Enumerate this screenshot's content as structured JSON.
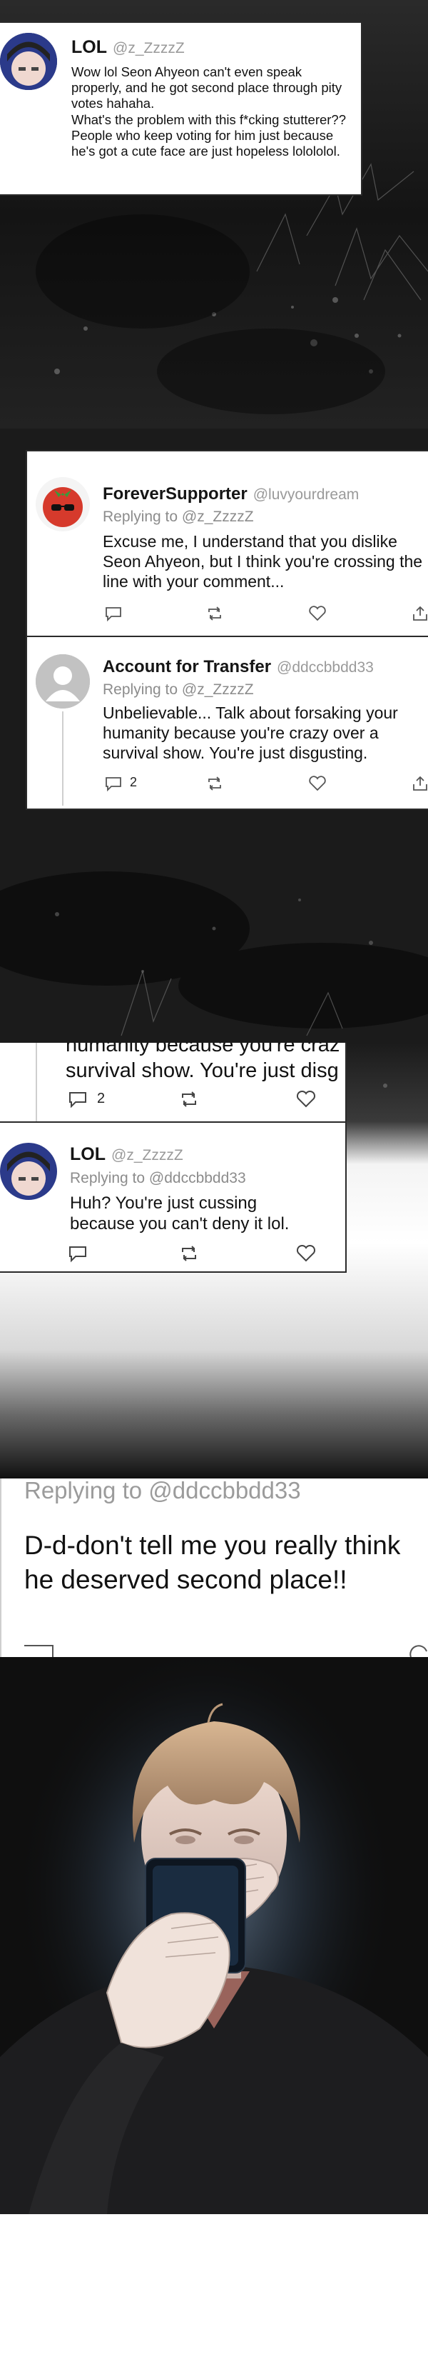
{
  "panel1": {
    "tweet": {
      "name": "LOL",
      "handle": "@z_ZzzzZ",
      "text": "Wow lol Seon Ahyeon can't even speak properly, and he got second place through pity votes hahaha.\nWhat's the problem with this f*cking stutterer?? People who keep voting for him just because he's got a cute face are just hopeless lolololol."
    }
  },
  "panel2": {
    "tweet1": {
      "name": "ForeverSupporter",
      "handle": "@luvyourdream",
      "replying_to": "Replying to @z_ZzzzZ",
      "text": "Excuse me, I understand that you dislike Seon Ahyeon, but I think you're crossing the line with your comment..."
    },
    "tweet2": {
      "name": "Account for Transfer",
      "handle": "@ddccbbdd33",
      "replying_to": "Replying to @z_ZzzzZ",
      "text": "Unbelievable... Talk about forsaking your humanity because you're crazy over a survival show. You're just disgusting.",
      "reply_count": "2"
    }
  },
  "panel3": {
    "partial_line_top": "humanity because you're craz",
    "partial_line": "survival show. You're just disg",
    "reply_count": "2",
    "tweet": {
      "name": "LOL",
      "handle": "@z_ZzzzZ",
      "replying_to": "Replying to @ddccbbdd33",
      "text": "Huh? You're just cussing because you can't deny it lol."
    }
  },
  "panel4": {
    "replying_to": "Replying to @ddccbbdd33",
    "text": "D-d-don't tell me you really think he deserved second place!!"
  },
  "colors": {
    "card_border": "#2a2a2a",
    "handle_gray": "#9a9a9a",
    "dark_bg": "#101010"
  }
}
